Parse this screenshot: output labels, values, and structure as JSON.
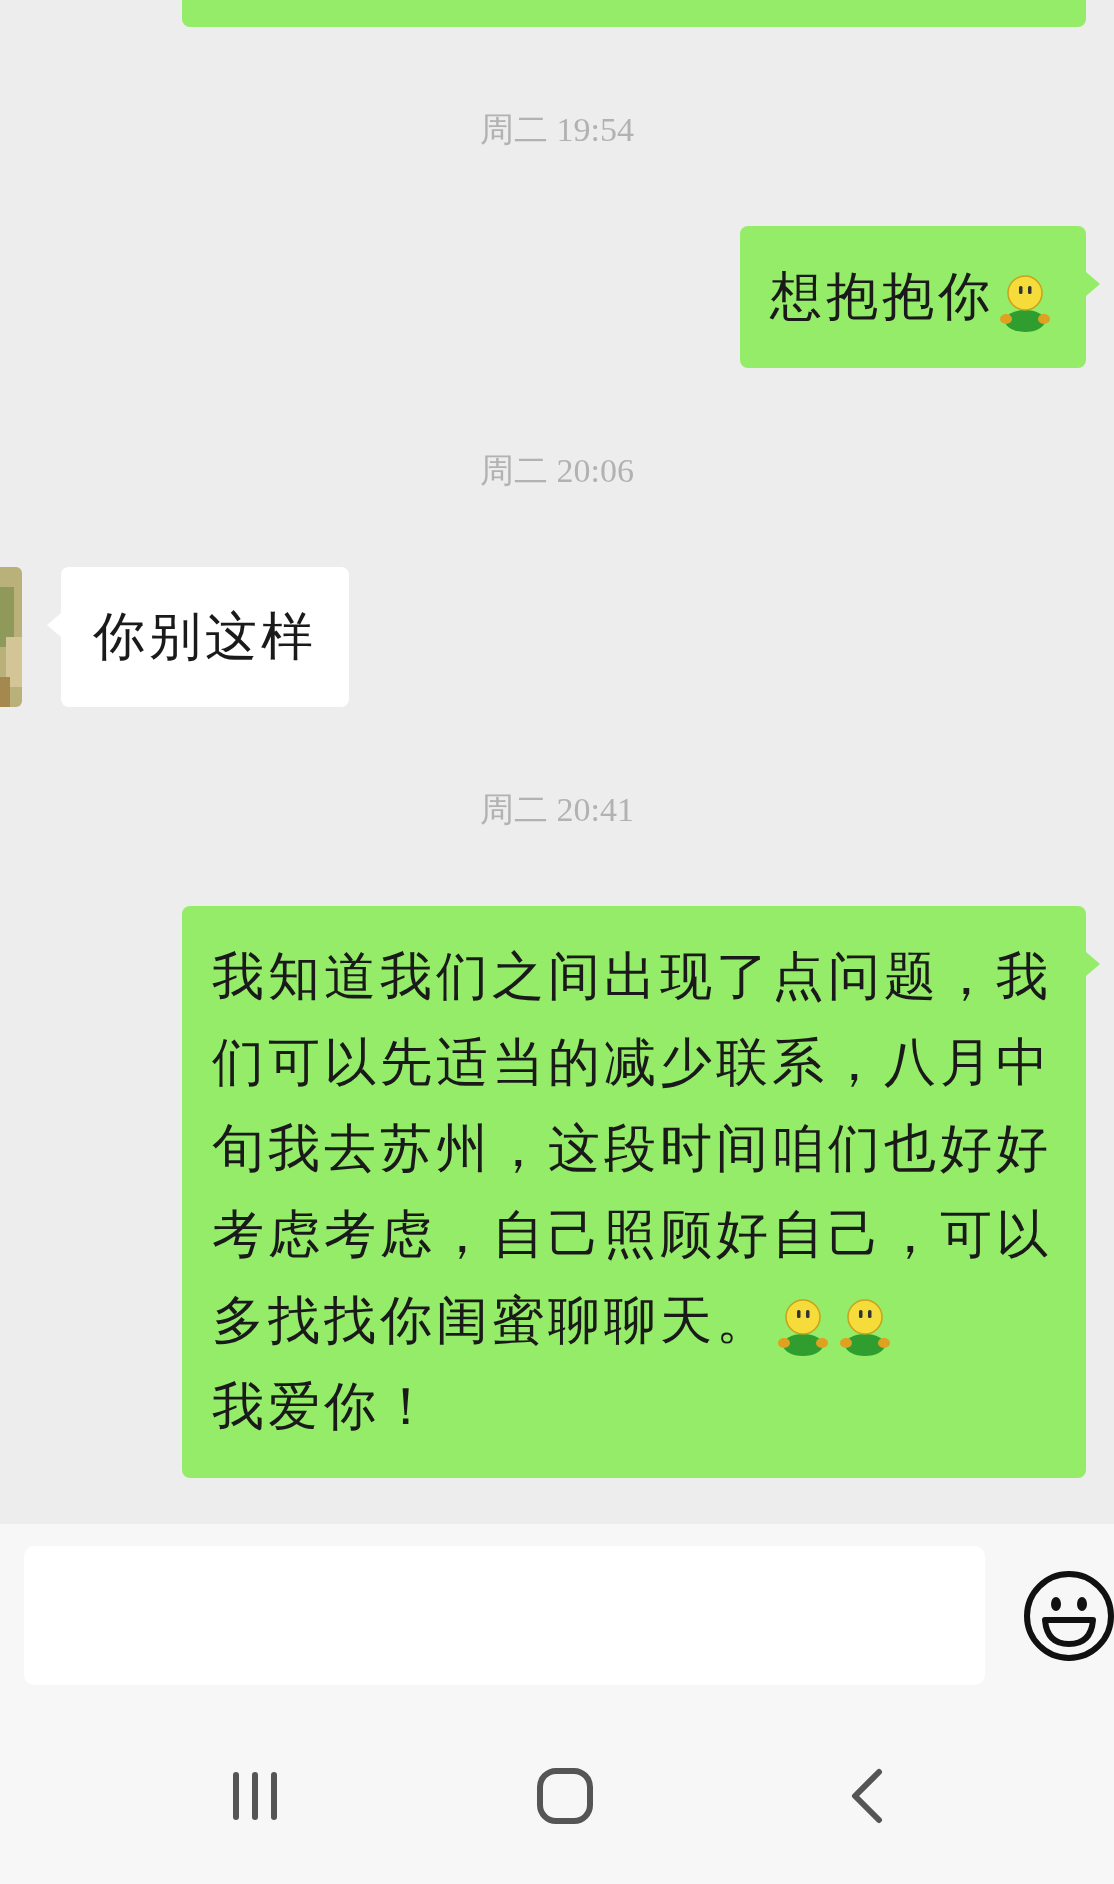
{
  "messages": [
    {
      "kind": "clipped"
    },
    {
      "kind": "time",
      "text": "周二 19:54"
    },
    {
      "kind": "sent",
      "parts": [
        {
          "kind": "text",
          "text": "想抱抱你"
        },
        {
          "kind": "emoji"
        }
      ]
    },
    {
      "kind": "time",
      "text": "周二 20:06"
    },
    {
      "kind": "received",
      "parts": [
        {
          "kind": "text",
          "text": "你别这样"
        }
      ]
    },
    {
      "kind": "time",
      "text": "周二 20:41"
    },
    {
      "kind": "sent",
      "parts": [
        {
          "kind": "text",
          "text": "我知道我们之间出现了点问题，我们可以先适当的减少联系，八月中旬我去苏州，这段时间咱们也好好考虑考虑，自己照顾好自己，可以"
        },
        {
          "kind": "break"
        },
        {
          "kind": "text",
          "text": "多找找你闺蜜聊聊天。"
        },
        {
          "kind": "emoji"
        },
        {
          "kind": "emoji"
        },
        {
          "kind": "break"
        },
        {
          "kind": "text",
          "text": "我爱你！"
        }
      ]
    }
  ]
}
